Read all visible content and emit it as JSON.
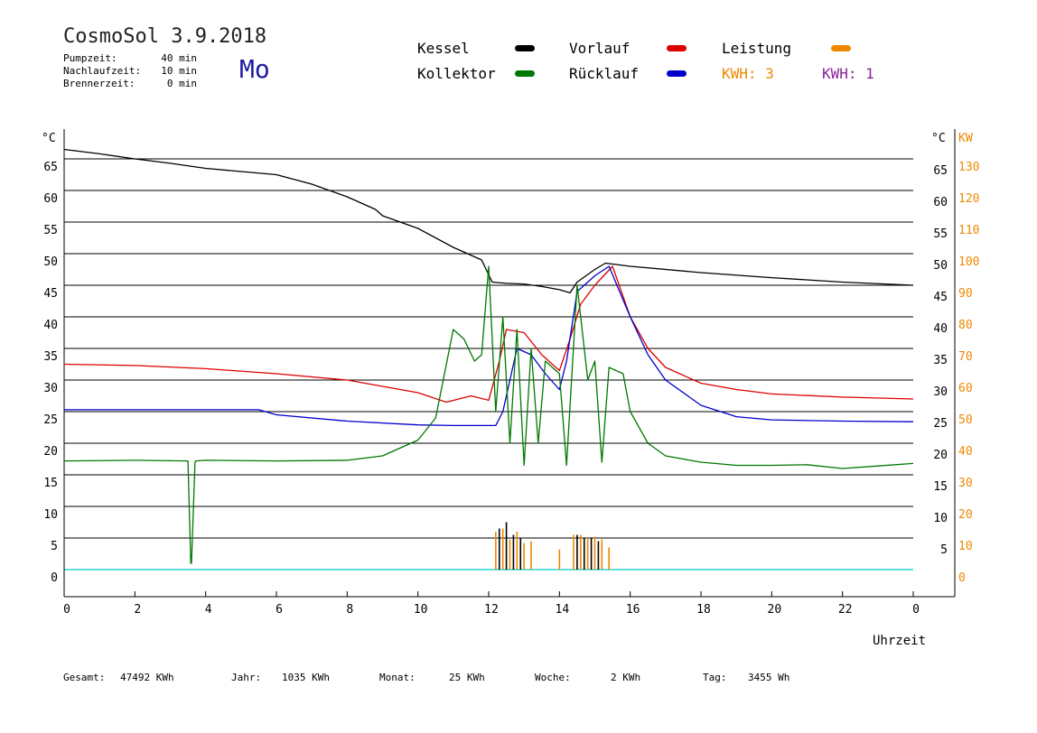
{
  "header": {
    "title": "CosmoSol 3.9.2018",
    "day": "Mo",
    "info": [
      {
        "label": "Pumpzeit:",
        "value": "40 min"
      },
      {
        "label": "Nachlaufzeit:",
        "value": "10 min"
      },
      {
        "label": "Brennerzeit:",
        "value": "0 min"
      }
    ]
  },
  "legend": {
    "kessel": "Kessel",
    "kollektor": "Kollektor",
    "vorlauf": "Vorlauf",
    "ruecklauf": "Rücklauf",
    "leistung": "Leistung",
    "kwh1": "KWH: 3",
    "kwh2": "KWH: 1"
  },
  "footer": {
    "gesamt_label": "Gesamt:",
    "gesamt_value": "47492 KWh",
    "jahr_label": "Jahr:",
    "jahr_value": "1035 KWh",
    "monat_label": "Monat:",
    "monat_value": "25 KWh",
    "woche_label": "Woche:",
    "woche_value": "2 KWh",
    "tag_label": "Tag:",
    "tag_value": "3455 Wh"
  },
  "colors": {
    "kessel": "#000000",
    "kollektor": "#007700",
    "vorlauf": "#dd0000",
    "ruecklauf": "#0000cc",
    "leistung": "#ee8800",
    "kwh1": "#ee8800",
    "kwh2": "#882299",
    "baseline": "#00cccc"
  },
  "chart_data": {
    "type": "line",
    "xlabel": "Uhrzeit",
    "ylabel_left": "°C",
    "ylabel_right_1": "°C",
    "ylabel_right_2": "KW",
    "xlim": [
      0,
      24
    ],
    "ylim": [
      -4,
      70
    ],
    "x_ticks": [
      "0",
      "2",
      "4",
      "6",
      "8",
      "10",
      "12",
      "14",
      "16",
      "18",
      "20",
      "22",
      "0"
    ],
    "y_ticks_left": [
      0,
      5,
      10,
      15,
      20,
      25,
      30,
      35,
      40,
      45,
      50,
      55,
      60,
      65
    ],
    "y_ticks_right": [
      5,
      10,
      15,
      20,
      25,
      30,
      35,
      40,
      45,
      50,
      55,
      60,
      65
    ],
    "y_ticks_kw": [
      0,
      10,
      20,
      30,
      40,
      50,
      60,
      70,
      80,
      90,
      100,
      110,
      120,
      130
    ],
    "series": [
      {
        "name": "Kessel",
        "color_key": "kessel",
        "x": [
          0,
          1,
          2,
          3,
          4,
          5,
          6,
          7,
          8,
          8.8,
          9,
          10,
          11,
          11.8,
          12.1,
          12.5,
          13,
          13.5,
          14,
          14.3,
          14.5,
          15,
          15.3,
          16,
          18,
          20,
          22,
          24
        ],
        "y": [
          66.5,
          65.8,
          65,
          64.3,
          63.5,
          63,
          62.5,
          61,
          59,
          57,
          56,
          54,
          51,
          49,
          45.5,
          45.3,
          45.2,
          44.8,
          44.3,
          43.8,
          45.5,
          47.5,
          48.5,
          48,
          47,
          46.2,
          45.5,
          45
        ]
      },
      {
        "name": "Vorlauf",
        "color_key": "vorlauf",
        "x": [
          0,
          2,
          4,
          6,
          8,
          10,
          10.8,
          11.5,
          12,
          12.3,
          12.5,
          13,
          13.5,
          14,
          14.3,
          14.6,
          15,
          15.5,
          16,
          16.5,
          17,
          18,
          19,
          20,
          22,
          24
        ],
        "y": [
          32.5,
          32.3,
          31.8,
          31,
          30,
          28,
          26.5,
          27.5,
          26.8,
          33,
          38,
          37.5,
          34,
          31.5,
          36.5,
          42,
          45,
          48,
          40,
          35,
          32,
          29.5,
          28.5,
          27.8,
          27.3,
          27
        ]
      },
      {
        "name": "Rücklauf",
        "color_key": "ruecklauf",
        "x": [
          0,
          2,
          4,
          5.5,
          6,
          8,
          10,
          11,
          12.2,
          12.4,
          12.8,
          13.2,
          13.6,
          14,
          14.2,
          14.5,
          15,
          15.4,
          16,
          16.5,
          17,
          18,
          19,
          20,
          22,
          24
        ],
        "y": [
          25.3,
          25.3,
          25.3,
          25.3,
          24.5,
          23.5,
          22.9,
          22.8,
          22.8,
          25,
          35,
          34,
          31,
          28.5,
          33,
          44,
          46.5,
          48,
          40,
          34,
          30,
          26,
          24.2,
          23.7,
          23.5,
          23.4
        ]
      },
      {
        "name": "Kollektor",
        "color_key": "kollektor",
        "x": [
          0,
          2,
          3.5,
          3.58,
          3.6,
          3.7,
          3.72,
          4,
          6,
          8,
          9,
          10,
          10.5,
          11,
          11.3,
          11.6,
          11.8,
          12,
          12.2,
          12.4,
          12.6,
          12.8,
          13,
          13.2,
          13.4,
          13.6,
          14,
          14.2,
          14.5,
          14.8,
          15,
          15.2,
          15.4,
          15.8,
          16,
          16.5,
          17,
          18,
          19,
          20,
          21,
          22,
          23,
          24
        ],
        "y": [
          17.2,
          17.3,
          17.2,
          1,
          1,
          17,
          17.2,
          17.3,
          17.2,
          17.3,
          18,
          20.5,
          24,
          38,
          36.5,
          33,
          34,
          48,
          25,
          40,
          20,
          38,
          16.5,
          35,
          20,
          33,
          31,
          16.5,
          45,
          30,
          33,
          17,
          32,
          31,
          25,
          20,
          18,
          17,
          16.5,
          16.5,
          16.6,
          16,
          16.4,
          16.8
        ]
      }
    ],
    "spikes": [
      {
        "name": "Leistung",
        "color_key": "leistung",
        "x": [
          12.2,
          12.4,
          12.6,
          12.8,
          13.0,
          13.2,
          14.0,
          14.4,
          14.6,
          14.8,
          15.0,
          15.2,
          15.4
        ],
        "y": [
          6,
          6.5,
          4.8,
          6,
          4.2,
          4.5,
          3.2,
          5.5,
          5.5,
          5,
          5.2,
          4.8,
          3.5
        ]
      },
      {
        "name": "Kessel-Spikes",
        "color_key": "kessel",
        "x": [
          12.3,
          12.5,
          12.7,
          12.9,
          14.5,
          14.7,
          14.9,
          15.1
        ],
        "y": [
          6.5,
          7.5,
          5.5,
          5,
          5.5,
          5,
          5,
          4.5
        ]
      }
    ]
  }
}
